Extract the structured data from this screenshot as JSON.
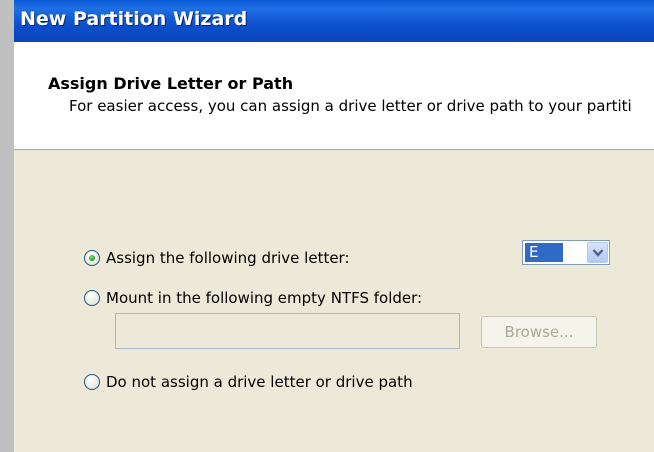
{
  "window": {
    "title": "New Partition Wizard"
  },
  "header": {
    "title": "Assign Drive Letter or Path",
    "subtitle": "For easier access, you can assign a drive letter or drive path to your partiti"
  },
  "options": [
    {
      "label": "Assign the following drive letter:",
      "selected": true
    },
    {
      "label": "Mount in the following empty NTFS folder:",
      "selected": false
    },
    {
      "label": "Do not assign a drive letter or drive path",
      "selected": false
    }
  ],
  "drive_letter": {
    "value": "E"
  },
  "folder_path": {
    "value": ""
  },
  "browse_button": {
    "label": "Browse...",
    "enabled": false
  },
  "colors": {
    "titlebar": "#0b4fcc",
    "selection": "#316ac5",
    "dialog_bg": "#ece9d8"
  }
}
